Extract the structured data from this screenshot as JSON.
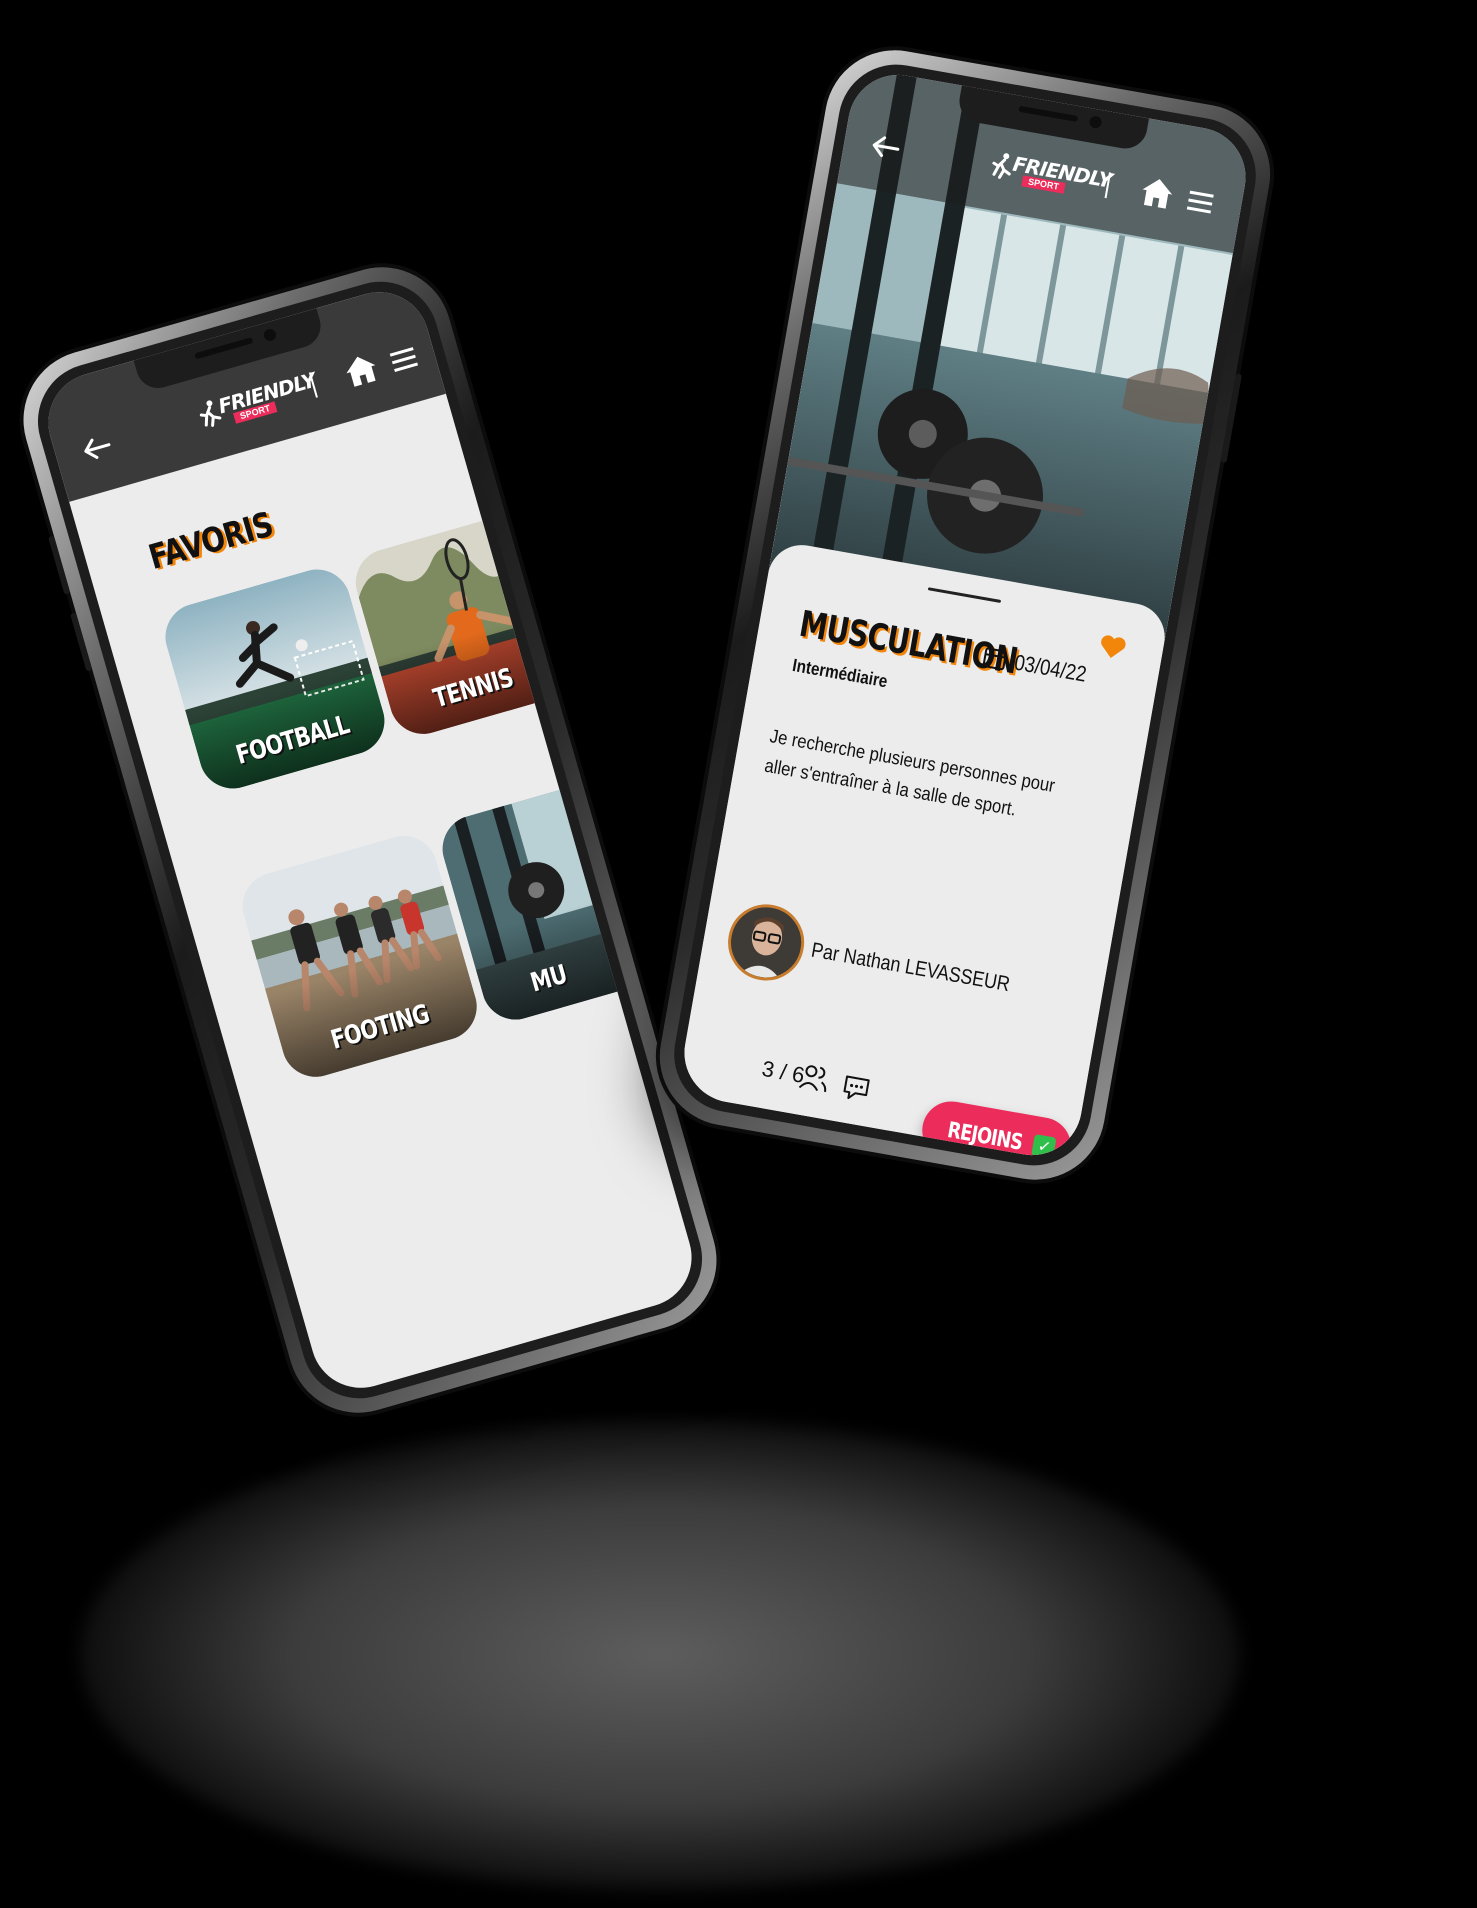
{
  "app": {
    "brand_word": "FRIENDLY",
    "brand_tag": "SPORT"
  },
  "favorites_screen": {
    "title": "FAVORIS",
    "tiles": [
      {
        "label": "FOOTBALL"
      },
      {
        "label": "TENNIS"
      },
      {
        "label": "FOOTING"
      },
      {
        "label": "MU"
      }
    ]
  },
  "event_screen": {
    "title": "MUSCULATION",
    "level": "Intermédiaire",
    "date": "03/04/22",
    "description": "Je recherche plusieurs personnes pour aller s'entraîner à la salle de sport.",
    "author": "Par Nathan LEVASSEUR",
    "participants": "3 / 6",
    "join_label": "REJOINS",
    "favorite": true
  },
  "colors": {
    "accent_pink": "#ec2d5b",
    "accent_orange": "#f2860b",
    "header_dark": "#3a3a3a",
    "screen_bg": "#ececec"
  },
  "icons": [
    "back-arrow-icon",
    "runner-logo-icon",
    "home-icon",
    "hamburger-menu-icon",
    "heart-icon",
    "calendar-icon",
    "people-icon",
    "chat-icon",
    "checkmark-icon"
  ]
}
